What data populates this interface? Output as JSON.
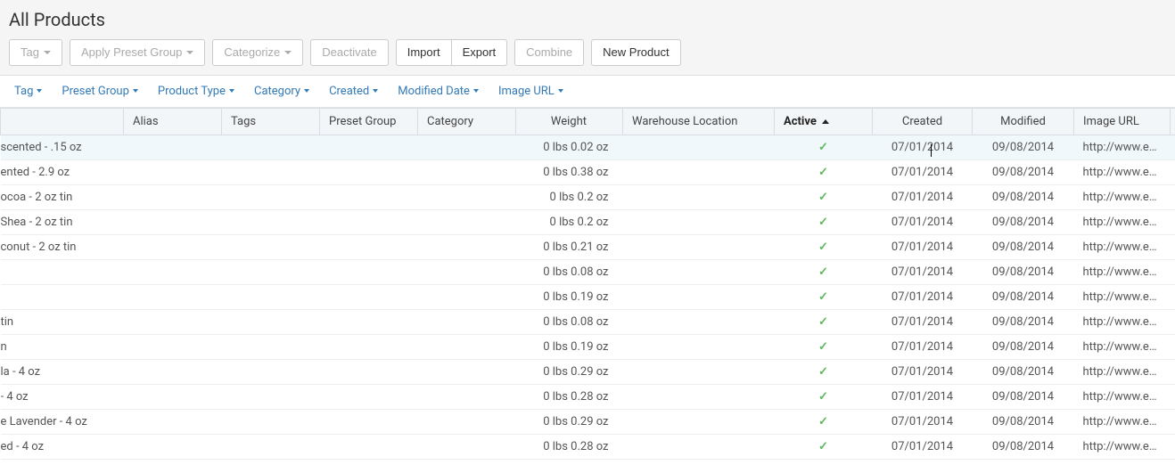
{
  "header": {
    "title": "All Products",
    "buttons": {
      "tag": "Tag",
      "apply_preset": "Apply Preset Group",
      "categorize": "Categorize",
      "deactivate": "Deactivate",
      "import": "Import",
      "export": "Export",
      "combine": "Combine",
      "new_product": "New Product"
    }
  },
  "filters": {
    "tag": "Tag",
    "preset_group": "Preset Group",
    "product_type": "Product Type",
    "category": "Category",
    "created": "Created",
    "modified_date": "Modified Date",
    "image_url": "Image URL"
  },
  "columns": {
    "alias": "Alias",
    "tags": "Tags",
    "preset_group": "Preset Group",
    "category": "Category",
    "weight": "Weight",
    "warehouse_location": "Warehouse Location",
    "active": "Active",
    "created": "Created",
    "modified": "Modified",
    "image_url": "Image URL"
  },
  "rows": [
    {
      "name": "scented - .15 oz",
      "weight": "0 lbs 0.02 oz",
      "active": true,
      "created": "07/01/2014",
      "modified": "09/08/2014",
      "image_url": "http://www.eart...",
      "extra": "0"
    },
    {
      "name": "ented - 2.9 oz",
      "weight": "0 lbs 0.38 oz",
      "active": true,
      "created": "07/01/2014",
      "modified": "09/08/2014",
      "image_url": "http://www.eart...",
      "extra": "0"
    },
    {
      "name": "ocoa - 2 oz tin",
      "weight": "0 lbs 0.2 oz",
      "active": true,
      "created": "07/01/2014",
      "modified": "09/08/2014",
      "image_url": "http://www.eart...",
      "extra": "0"
    },
    {
      "name": "Shea - 2 oz tin",
      "weight": "0 lbs 0.2 oz",
      "active": true,
      "created": "07/01/2014",
      "modified": "09/08/2014",
      "image_url": "http://www.eart...",
      "extra": "0"
    },
    {
      "name": "conut - 2 oz tin",
      "weight": "0 lbs 0.21 oz",
      "active": true,
      "created": "07/01/2014",
      "modified": "09/08/2014",
      "image_url": "http://www.eart...",
      "extra": "0"
    },
    {
      "name": "",
      "weight": "0 lbs 0.08 oz",
      "active": true,
      "created": "07/01/2014",
      "modified": "09/08/2014",
      "image_url": "http://www.eart...",
      "extra": "0"
    },
    {
      "name": "",
      "weight": "0 lbs 0.19 oz",
      "active": true,
      "created": "07/01/2014",
      "modified": "09/08/2014",
      "image_url": "http://www.eart...",
      "extra": "0"
    },
    {
      "name": "tin",
      "weight": "0 lbs 0.08 oz",
      "active": true,
      "created": "07/01/2014",
      "modified": "09/08/2014",
      "image_url": "http://www.eart...",
      "extra": "0"
    },
    {
      "name": "n",
      "weight": "0 lbs 0.19 oz",
      "active": true,
      "created": "07/01/2014",
      "modified": "09/08/2014",
      "image_url": "http://www.eart...",
      "extra": "0"
    },
    {
      "name": "la - 4 oz",
      "weight": "0 lbs 0.29 oz",
      "active": true,
      "created": "07/01/2014",
      "modified": "09/08/2014",
      "image_url": "http://www.eart...",
      "extra": "0"
    },
    {
      "name": " - 4 oz",
      "weight": "0 lbs 0.28 oz",
      "active": true,
      "created": "07/01/2014",
      "modified": "09/08/2014",
      "image_url": "http://www.eart...",
      "extra": "0"
    },
    {
      "name": "e Lavender - 4 oz",
      "weight": "0 lbs 0.29 oz",
      "active": true,
      "created": "07/01/2014",
      "modified": "09/08/2014",
      "image_url": "http://www.eart...",
      "extra": "0"
    },
    {
      "name": "ed - 4 oz",
      "weight": "0 lbs 0.28 oz",
      "active": true,
      "created": "07/01/2014",
      "modified": "09/08/2014",
      "image_url": "http://www.eart...",
      "extra": "0"
    }
  ]
}
